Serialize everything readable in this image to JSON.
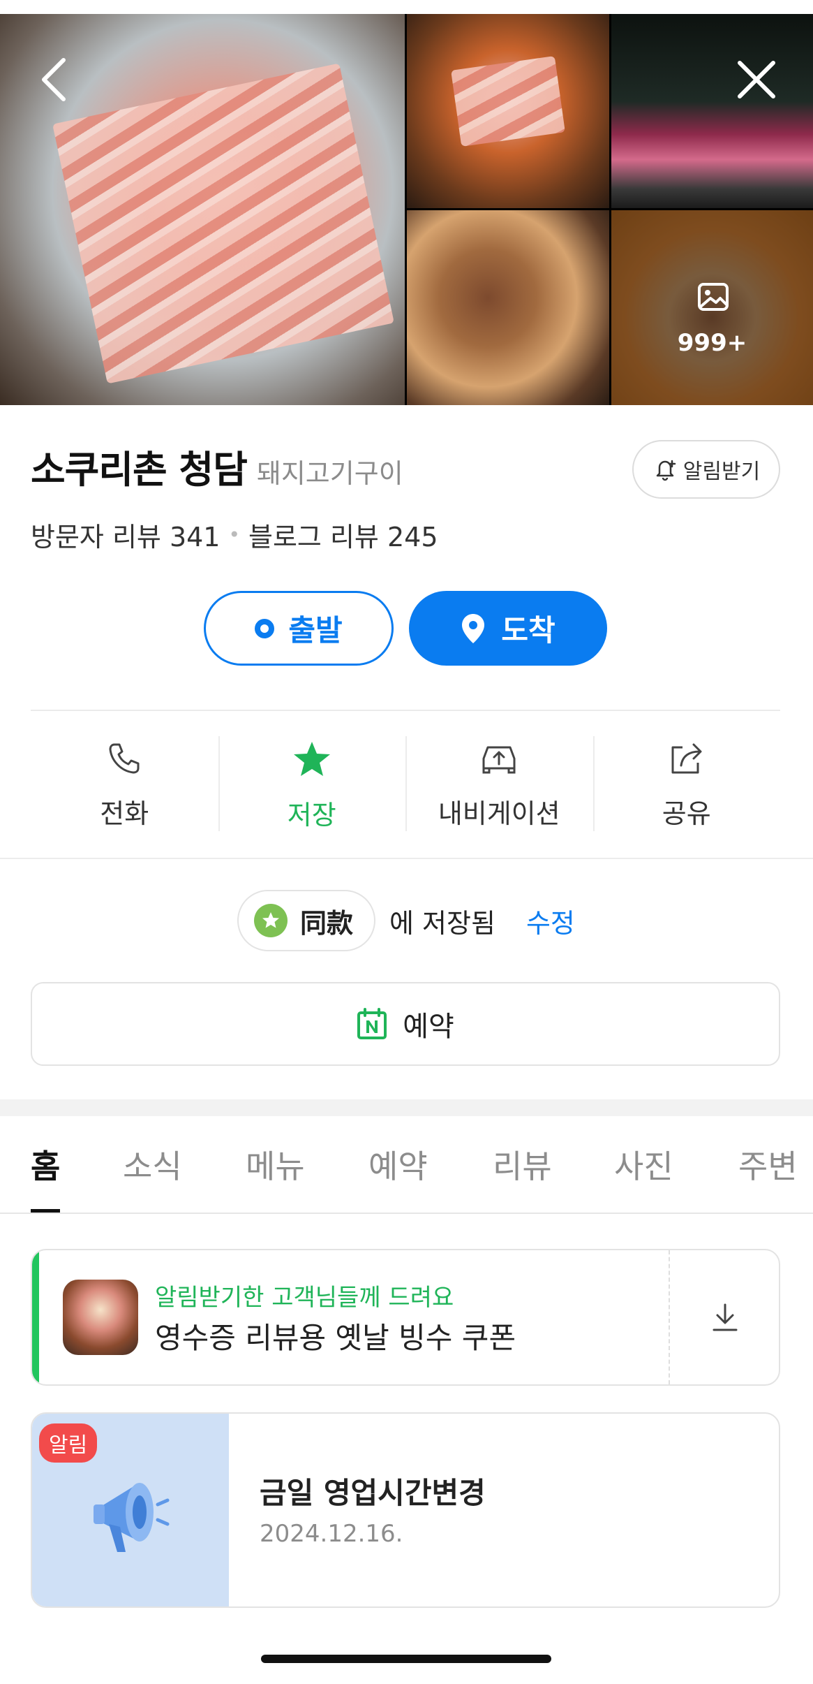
{
  "gallery": {
    "more_count": "999+"
  },
  "place": {
    "name": "소쿠리촌 청담",
    "category": "돼지고기구이",
    "alarm_label": "알림받기",
    "visitor_reviews": "방문자 리뷰 341",
    "review_separator": "•",
    "blog_reviews": "블로그 리뷰 245"
  },
  "route": {
    "start_label": "출발",
    "end_label": "도착"
  },
  "actions": [
    {
      "label": "전화",
      "icon": "phone-icon"
    },
    {
      "label": "저장",
      "icon": "star-icon",
      "active_color": "#1fb458"
    },
    {
      "label": "내비게이션",
      "icon": "car-navigation-icon"
    },
    {
      "label": "공유",
      "icon": "share-icon"
    }
  ],
  "saved": {
    "folder_name": "同款",
    "saved_text": "에 저장됨",
    "edit_label": "수정"
  },
  "reserve": {
    "label": "예약"
  },
  "tabs": [
    {
      "label": "홈",
      "active": true
    },
    {
      "label": "소식"
    },
    {
      "label": "메뉴"
    },
    {
      "label": "예약"
    },
    {
      "label": "리뷰"
    },
    {
      "label": "사진"
    },
    {
      "label": "주변"
    }
  ],
  "coupon": {
    "subtitle": "알림받기한 고객님들께 드려요",
    "title": "영수증 리뷰용 옛날 빙수 쿠폰"
  },
  "notice": {
    "badge": "알림",
    "title": "금일 영업시간변경",
    "date": "2024.12.16."
  },
  "colors": {
    "accent_blue": "#0a7cf0",
    "saved_green": "#1fb458",
    "alert_red": "#f24b4b"
  }
}
